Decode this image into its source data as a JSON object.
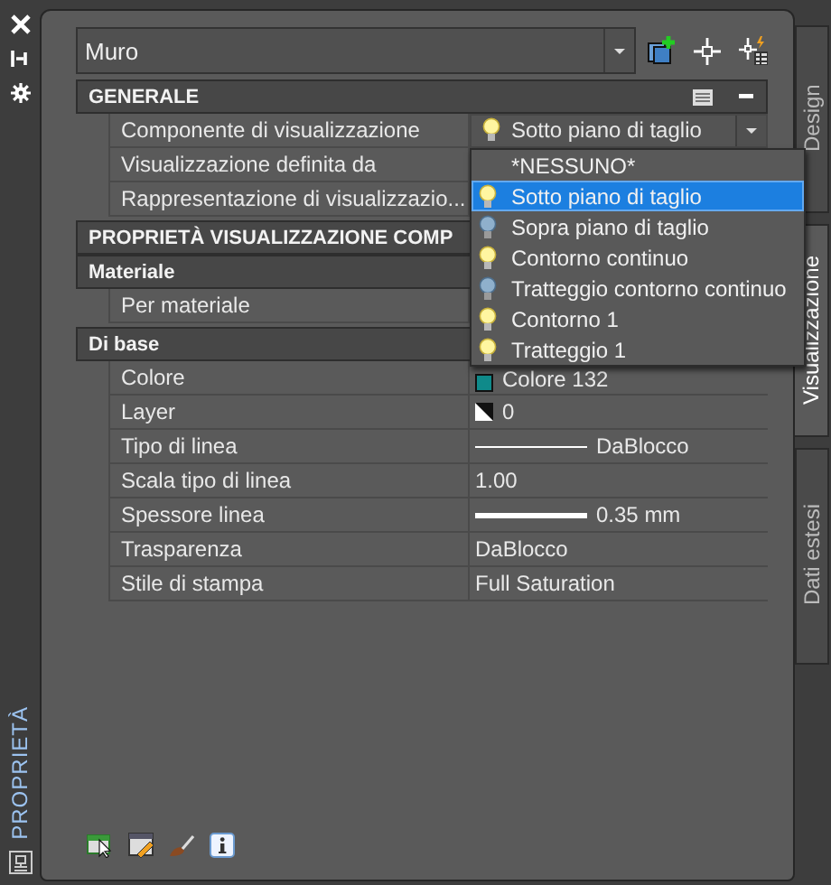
{
  "side_strip": {
    "title": "PROPRIETÀ"
  },
  "object_selector": {
    "value": "Muro"
  },
  "rows": [
    {
      "kind": "section",
      "label": "GENERALE"
    },
    {
      "kind": "property",
      "label": "Componente di visualizzazione",
      "value": {
        "kind": "combo",
        "text": "Sotto piano di taglio"
      }
    },
    {
      "kind": "property",
      "label": "Visualizzazione definita da"
    },
    {
      "kind": "property",
      "label": "Rappresentazione  di  visualizzazio..."
    },
    {
      "kind": "section",
      "label": "PROPRIETÀ VISUALIZZAZIONE COMP"
    },
    {
      "kind": "group",
      "label": "Materiale"
    },
    {
      "kind": "property",
      "label": "Per materiale"
    },
    {
      "kind": "group",
      "label": "Di base"
    },
    {
      "kind": "property",
      "label": "Colore",
      "value": {
        "kind": "swatch",
        "text": "Colore 132"
      }
    },
    {
      "kind": "property",
      "label": "Layer",
      "value": {
        "kind": "layer",
        "text": "0"
      }
    },
    {
      "kind": "property",
      "label": "Tipo di linea",
      "value": {
        "kind": "thin-line",
        "text": "DaBlocco"
      }
    },
    {
      "kind": "property",
      "label": "Scala tipo di linea",
      "value": {
        "kind": "text",
        "text": "1.00"
      }
    },
    {
      "kind": "property",
      "label": "Spessore linea",
      "value": {
        "kind": "thick-line",
        "text": "0.35 mm"
      }
    },
    {
      "kind": "property",
      "label": "Trasparenza",
      "value": {
        "kind": "text",
        "text": "DaBlocco"
      }
    },
    {
      "kind": "property",
      "label": "Stile di stampa",
      "value": {
        "kind": "text",
        "text": "Full Saturation"
      }
    }
  ],
  "dropdown": {
    "items": [
      {
        "label": "*NESSUNO*",
        "kind": "none",
        "selected": false
      },
      {
        "label": "Sotto piano di taglio",
        "kind": "bulb-on",
        "selected": true
      },
      {
        "label": "Sopra piano di taglio",
        "kind": "bulb-off",
        "selected": false
      },
      {
        "label": "Contorno continuo",
        "kind": "bulb-on",
        "selected": false
      },
      {
        "label": "Tratteggio contorno continuo",
        "kind": "bulb-off",
        "selected": false
      },
      {
        "label": "Contorno 1",
        "kind": "bulb-on",
        "selected": false
      },
      {
        "label": "Tratteggio 1",
        "kind": "bulb-on",
        "selected": false
      }
    ]
  },
  "tabs": [
    {
      "label": "Design",
      "selected": false
    },
    {
      "label": "Visualizzazione",
      "selected": true
    },
    {
      "label": "Dati estesi",
      "selected": false
    }
  ]
}
